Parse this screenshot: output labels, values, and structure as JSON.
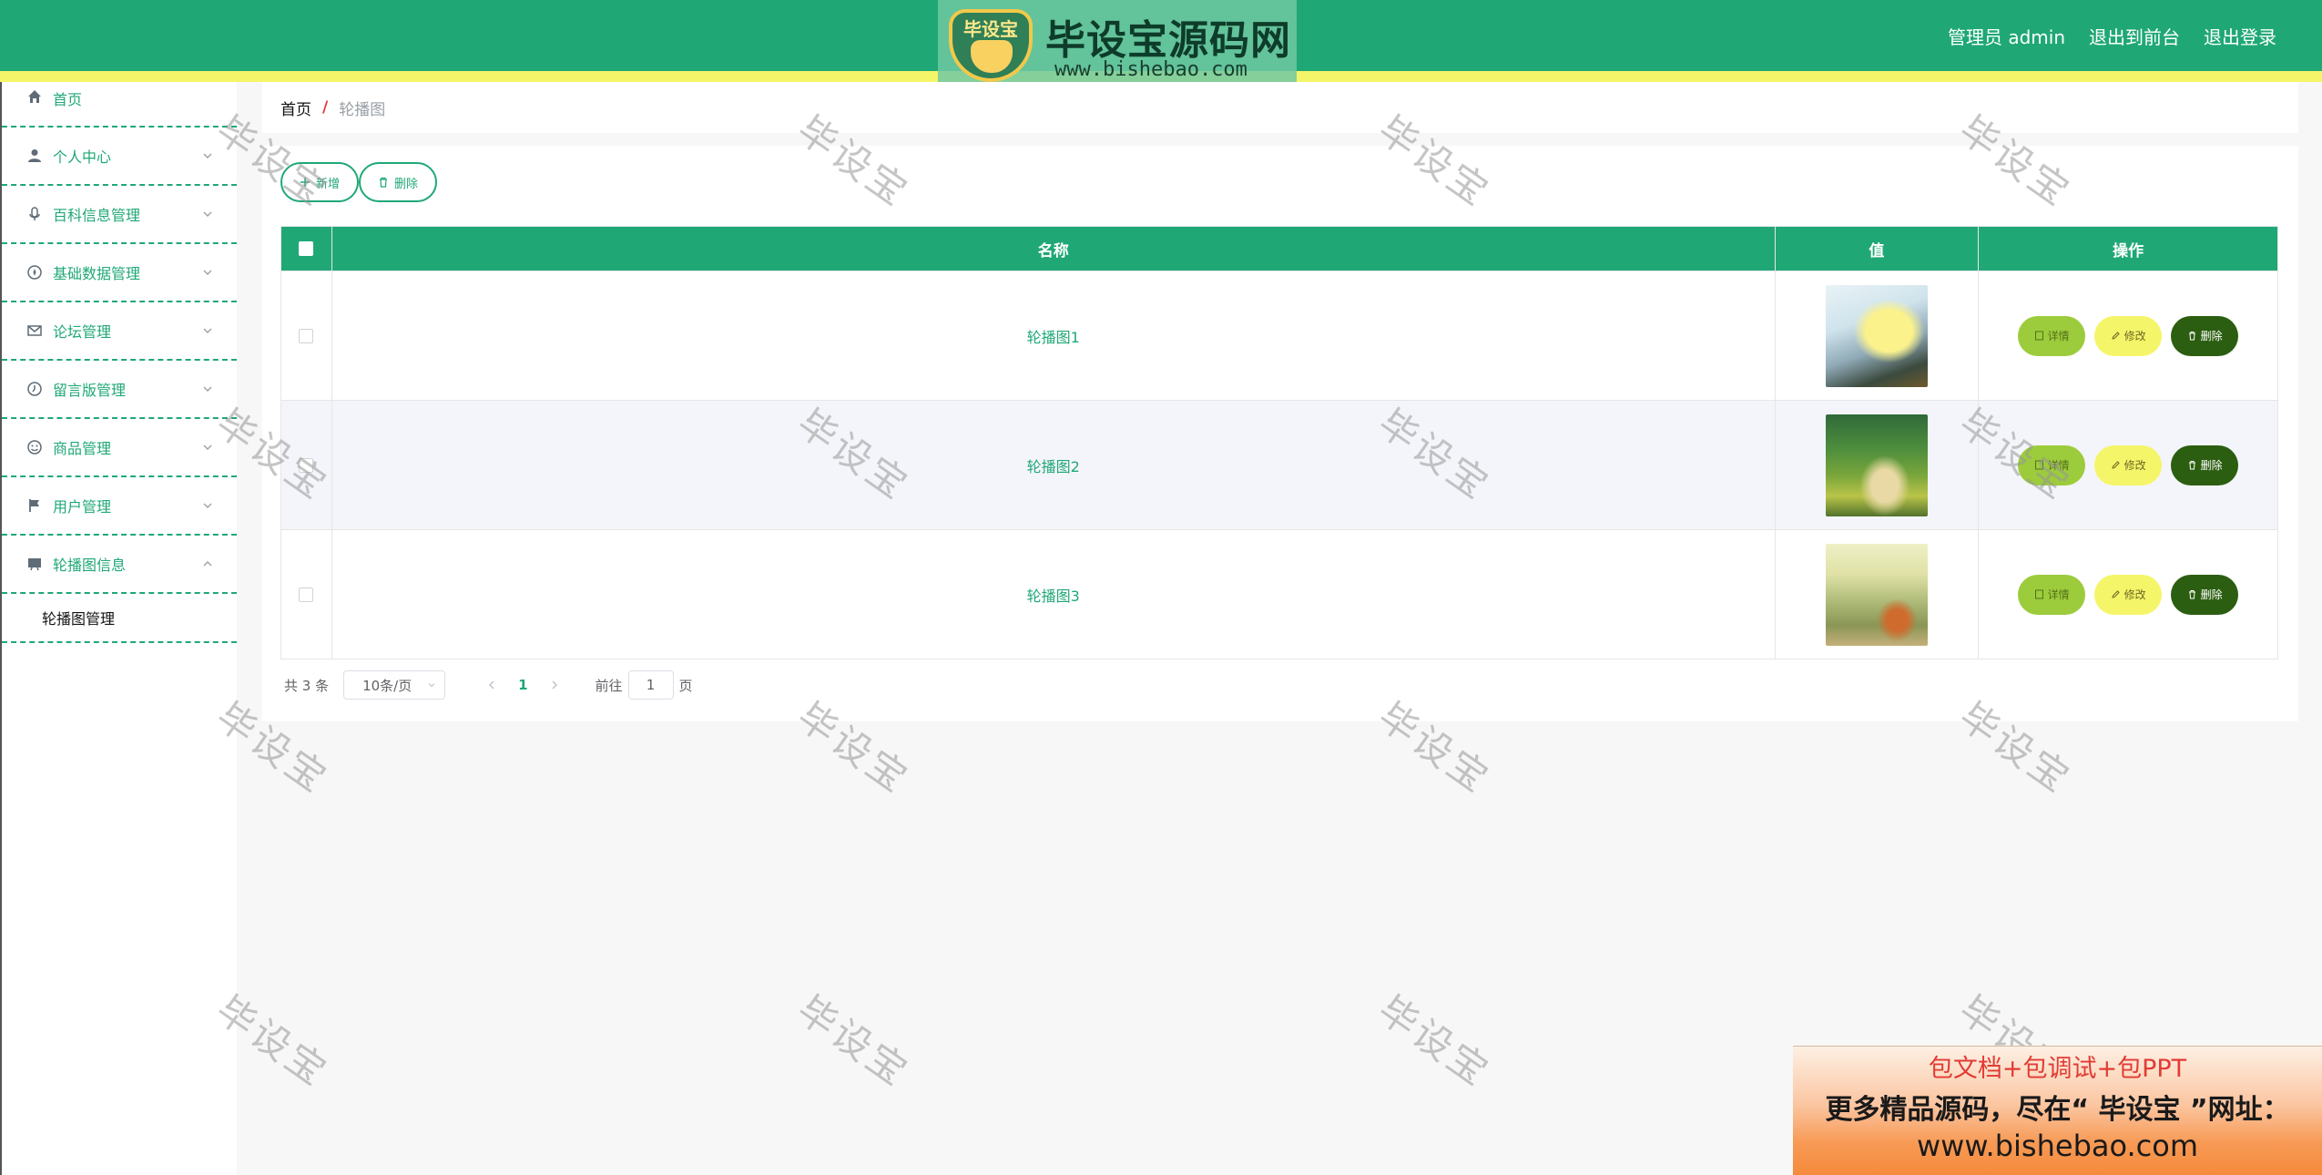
{
  "header": {
    "brand_badge": "毕设宝",
    "brand_title": "毕设宝源码网",
    "brand_url": "www.bishebao.com",
    "admin_label": "管理员 admin",
    "to_front_label": "退出到前台",
    "logout_label": "退出登录"
  },
  "sidebar": {
    "items": [
      {
        "label": "首页",
        "icon": "home-icon"
      },
      {
        "label": "个人中心",
        "icon": "user-icon"
      },
      {
        "label": "百科信息管理",
        "icon": "microphone-icon"
      },
      {
        "label": "基础数据管理",
        "icon": "compass-icon"
      },
      {
        "label": "论坛管理",
        "icon": "mail-icon"
      },
      {
        "label": "留言版管理",
        "icon": "clock-icon"
      },
      {
        "label": "商品管理",
        "icon": "smile-icon"
      },
      {
        "label": "用户管理",
        "icon": "flag-icon"
      },
      {
        "label": "轮播图信息",
        "icon": "slides-icon"
      }
    ],
    "submenu_label": "轮播图管理"
  },
  "breadcrumb": {
    "home": "首页",
    "separator": "/",
    "current": "轮播图"
  },
  "toolbar": {
    "add_label": "新增",
    "delete_label": "删除"
  },
  "table": {
    "headers": {
      "name": "名称",
      "value": "值",
      "ops": "操作"
    },
    "rows": [
      {
        "name": "轮播图1"
      },
      {
        "name": "轮播图2"
      },
      {
        "name": "轮播图3"
      }
    ],
    "ops": {
      "detail": "详情",
      "edit": "修改",
      "delete": "删除"
    }
  },
  "pager": {
    "total": "共 3 条",
    "page_size": "10条/页",
    "current_page": "1",
    "goto_prefix": "前往",
    "goto_value": "1",
    "goto_suffix": "页"
  },
  "watermark": "毕设宝",
  "ad": {
    "line1": "包文档+包调试+包PPT",
    "line2": "更多精品源码，尽在“ 毕设宝 ”网址：",
    "line3": "www.bishebao.com"
  },
  "colors": {
    "primary": "#1fa876",
    "accent_yellow": "#f5f56a",
    "detail_btn": "#9ccc3c",
    "delete_btn": "#2c5e11",
    "danger_sep": "#e4393c"
  }
}
